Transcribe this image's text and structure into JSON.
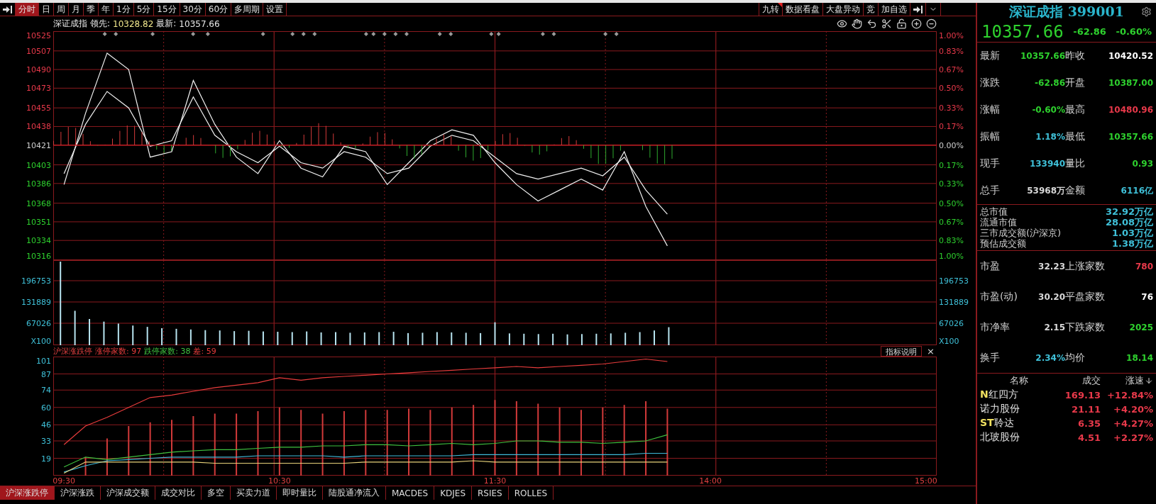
{
  "toolbar": {
    "tabs": [
      {
        "label": "分时",
        "selected": true
      },
      {
        "label": "日",
        "selected": false
      },
      {
        "label": "周",
        "selected": false
      },
      {
        "label": "月",
        "selected": false
      },
      {
        "label": "季",
        "selected": false
      },
      {
        "label": "年",
        "selected": false
      },
      {
        "label": "1分",
        "selected": false
      },
      {
        "label": "5分",
        "selected": false
      },
      {
        "label": "15分",
        "selected": false
      },
      {
        "label": "30分",
        "selected": false
      },
      {
        "label": "60分",
        "selected": false
      },
      {
        "label": "多周期",
        "selected": false
      },
      {
        "label": "设置",
        "selected": false
      }
    ],
    "buttons": [
      {
        "label": "九转",
        "flagged": true
      },
      {
        "label": "数据看盘",
        "flagged": false
      },
      {
        "label": "大盘异动",
        "flagged": false
      },
      {
        "label": "竞",
        "flagged": false
      },
      {
        "label": "加自选",
        "flagged": false
      }
    ]
  },
  "chart_header": {
    "name": "深证成指",
    "lead_label": "领先:",
    "lead_value": "10328.82",
    "latest_label": "最新:",
    "latest_value": "10357.66"
  },
  "price_chart": {
    "right_ticks": [
      "1.00%",
      "0.83%",
      "0.67%",
      "0.50%",
      "0.33%",
      "0.17%",
      "0.00%",
      "0.17%",
      "0.33%",
      "0.50%",
      "0.67%",
      "0.83%",
      "1.00%"
    ],
    "chart_data": {
      "type": "line",
      "grid": true,
      "ylim": [
        10316,
        10525
      ],
      "categories": [
        null,
        null,
        null,
        null,
        null,
        null,
        null,
        null,
        null,
        null,
        null,
        null,
        null,
        null,
        null,
        null,
        null,
        null,
        null,
        null,
        null,
        null,
        null,
        null,
        null,
        null,
        null,
        null,
        null,
        null,
        null,
        null,
        null,
        null,
        null,
        null,
        null,
        null,
        null,
        null,
        null
      ],
      "series": [
        {
          "color": "#f0f0f0",
          "values": [
            10395,
            10440,
            10470,
            10455,
            10420,
            10425,
            10465,
            10430,
            10415,
            10405,
            10420,
            10405,
            10400,
            10415,
            10410,
            10395,
            10400,
            10420,
            10430,
            10425,
            10410,
            10395,
            10390,
            10395,
            10400,
            10393,
            10410,
            10380,
            10358,
            null,
            null,
            null,
            null,
            null,
            null,
            null,
            null,
            null,
            null,
            null,
            null
          ]
        },
        {
          "color": "#f0f0f0",
          "values": [
            10385,
            10450,
            10505,
            10490,
            10410,
            10415,
            10480,
            10440,
            10410,
            10395,
            10425,
            10400,
            10392,
            10420,
            10415,
            10385,
            10405,
            10425,
            10435,
            10430,
            10405,
            10385,
            10370,
            10380,
            10390,
            10380,
            10415,
            10365,
            10329,
            null,
            null,
            null,
            null,
            null,
            null,
            null,
            null,
            null,
            null,
            null,
            null
          ]
        }
      ],
      "yticks": [
        {
          "value": 10525,
          "label": "10525"
        },
        {
          "value": 10507,
          "label": "10507"
        },
        {
          "value": 10490,
          "label": "10490"
        },
        {
          "value": 10473,
          "label": "10473"
        },
        {
          "value": 10455,
          "label": "10455"
        },
        {
          "value": 10438,
          "label": "10438"
        },
        {
          "value": 10421,
          "label": "10421"
        },
        {
          "value": 10403,
          "label": "10403"
        },
        {
          "value": 10386,
          "label": "10386"
        },
        {
          "value": 10368,
          "label": "10368"
        },
        {
          "value": 10351,
          "label": "10351"
        },
        {
          "value": 10334,
          "label": "10334"
        },
        {
          "value": 10316,
          "label": "10316"
        }
      ]
    }
  },
  "volume_chart": {
    "right_ticks": [
      "196753",
      "131889",
      "67026",
      "X100"
    ],
    "chart_data": {
      "type": "bar",
      "grid": true,
      "ylim": [
        0,
        259452
      ],
      "categories": [
        null,
        null,
        null,
        null,
        null,
        null,
        null,
        null,
        null,
        null,
        null,
        null,
        null,
        null,
        null,
        null,
        null,
        null,
        null,
        null,
        null,
        null,
        null,
        null,
        null,
        null,
        null,
        null,
        null,
        null,
        null,
        null,
        null,
        null,
        null,
        null,
        null,
        null,
        null,
        null,
        null,
        null,
        null,
        null,
        null,
        null,
        null,
        null,
        null,
        null,
        null,
        null,
        null,
        null,
        null,
        null,
        null,
        null,
        null,
        null,
        null
      ],
      "values": [
        255000,
        105000,
        80000,
        72000,
        66000,
        60000,
        56000,
        52000,
        50000,
        48000,
        46000,
        45000,
        43000,
        44000,
        42000,
        41000,
        40000,
        42000,
        39000,
        40000,
        38000,
        39000,
        40000,
        41000,
        37000,
        38000,
        40000,
        39000,
        38000,
        37000,
        70000,
        36000,
        35000,
        34000,
        35000,
        33000,
        34000,
        35000,
        36000,
        38000,
        40000,
        45000,
        55000,
        null,
        null,
        null,
        null,
        null,
        null,
        null,
        null,
        null,
        null,
        null,
        null,
        null,
        null,
        null,
        null,
        null,
        null
      ],
      "yticks": [
        {
          "value": 196753,
          "label": "196753"
        },
        {
          "value": 131889,
          "label": "131889"
        },
        {
          "value": 67026,
          "label": "67026"
        },
        {
          "value": 0,
          "label": "X100"
        }
      ]
    }
  },
  "indicator": {
    "title": "沪深涨跌停",
    "legend": [
      {
        "label": "涨停家数:",
        "value": "97",
        "color": "#e83c3c"
      },
      {
        "label": "跌停家数:",
        "value": "38",
        "color": "#3fc23f"
      },
      {
        "label": "差:",
        "value": "59",
        "color": "#e83c3c"
      }
    ],
    "help_button": "指标说明",
    "close": "×",
    "chart_data": {
      "type": "line",
      "grid": true,
      "ylim": [
        5,
        101
      ],
      "yticks": [
        19,
        33,
        46,
        60,
        74,
        87,
        101
      ],
      "categories": [
        "09:30",
        null,
        null,
        null,
        null,
        null,
        null,
        null,
        null,
        null,
        "10:30",
        null,
        null,
        null,
        null,
        null,
        null,
        null,
        null,
        null,
        "11:30",
        null,
        null,
        null,
        null,
        null,
        null,
        null,
        null,
        null,
        "14:00",
        null,
        null,
        null,
        null,
        null,
        null,
        null,
        null,
        null,
        "15:00"
      ],
      "series": [
        {
          "type": "bar",
          "color": "#d23a3a",
          "values": [
            5,
            20,
            35,
            45,
            48,
            50,
            53,
            55,
            55,
            57,
            60,
            58,
            55,
            57,
            58,
            58,
            59,
            58,
            60,
            62,
            66,
            65,
            63,
            60,
            58,
            60,
            62,
            65,
            59,
            null,
            null,
            null,
            null,
            null,
            null,
            null,
            null,
            null,
            null,
            null,
            null
          ]
        },
        {
          "color": "#e83c3c",
          "values": [
            30,
            45,
            52,
            60,
            68,
            70,
            73,
            76,
            78,
            80,
            84,
            82,
            84,
            85,
            86,
            87,
            88,
            89,
            90,
            91,
            92,
            93,
            92,
            93,
            94,
            95,
            97,
            99,
            97,
            null,
            null,
            null,
            null,
            null,
            null,
            null,
            null,
            null,
            null,
            null,
            null
          ]
        },
        {
          "color": "#3fc23f",
          "values": [
            12,
            20,
            18,
            20,
            22,
            24,
            25,
            26,
            26,
            27,
            28,
            28,
            29,
            29,
            30,
            30,
            29,
            30,
            31,
            30,
            31,
            33,
            33,
            32,
            32,
            31,
            32,
            33,
            38,
            null,
            null,
            null,
            null,
            null,
            null,
            null,
            null,
            null,
            null,
            null,
            null
          ]
        },
        {
          "color": "#3fb8d8",
          "values": [
            8,
            13,
            17,
            18,
            19,
            20,
            20,
            20,
            20,
            21,
            21,
            21,
            21,
            20,
            21,
            21,
            21,
            21,
            21,
            22,
            22,
            22,
            22,
            22,
            22,
            22,
            22,
            23,
            23,
            null,
            null,
            null,
            null,
            null,
            null,
            null,
            null,
            null,
            null,
            null,
            null
          ]
        },
        {
          "color": "#e8d27a",
          "values": [
            7,
            16,
            16,
            16,
            16,
            16,
            16,
            15,
            15,
            15,
            15,
            15,
            15,
            15,
            16,
            16,
            16,
            16,
            16,
            17,
            16,
            16,
            16,
            16,
            16,
            16,
            16,
            16,
            16,
            null,
            null,
            null,
            null,
            null,
            null,
            null,
            null,
            null,
            null,
            null,
            null
          ]
        }
      ]
    }
  },
  "bottom_tabs": [
    {
      "label": "沪深涨跌停",
      "selected": true
    },
    {
      "label": "沪深涨跌",
      "selected": false
    },
    {
      "label": "沪深成交额",
      "selected": false
    },
    {
      "label": "成交对比",
      "selected": false
    },
    {
      "label": "多空",
      "selected": false
    },
    {
      "label": "买卖力道",
      "selected": false
    },
    {
      "label": "即时量比",
      "selected": false
    },
    {
      "label": "陆股通净流入",
      "selected": false
    },
    {
      "label": "MACDES",
      "selected": false
    },
    {
      "label": "KDJES",
      "selected": false
    },
    {
      "label": "RSIES",
      "selected": false
    },
    {
      "label": "ROLLES",
      "selected": false
    }
  ],
  "quote": {
    "title": "深证成指 399001",
    "price": "10357.66",
    "change": "-62.86",
    "change_pct": "-0.60%",
    "color": "#2ed12e"
  },
  "stats": [
    {
      "label": "最新",
      "value": "10357.66",
      "color": "#2ed12e"
    },
    {
      "label": "昨收",
      "value": "10420.52",
      "color": "#ffffff"
    },
    {
      "label": "涨跌",
      "value": "-62.86",
      "color": "#2ed12e"
    },
    {
      "label": "开盘",
      "value": "10387.00",
      "color": "#2ed12e"
    },
    {
      "label": "涨幅",
      "value": "-0.60%",
      "color": "#2ed12e"
    },
    {
      "label": "最高",
      "value": "10480.96",
      "color": "#e8394a"
    },
    {
      "label": "振幅",
      "value": "1.18%",
      "color": "#3fc0d8"
    },
    {
      "label": "最低",
      "value": "10357.66",
      "color": "#2ed12e"
    },
    {
      "label": "现手",
      "value": "133940",
      "color": "#3fc0d8"
    },
    {
      "label": "量比",
      "value": "0.93",
      "color": "#2ed12e"
    },
    {
      "label": "总手",
      "value": "53968万",
      "color": "#d8d8d8"
    },
    {
      "label": "金额",
      "value": "6116亿",
      "color": "#3fc0d8"
    }
  ],
  "market_value": [
    {
      "label": "总市值",
      "value": "32.92万亿"
    },
    {
      "label": "流通市值",
      "value": "28.08万亿"
    },
    {
      "label": "三市成交额(沪深京)",
      "value": "1.03万亿"
    },
    {
      "label": "预估成交额",
      "value": "1.38万亿"
    }
  ],
  "valuation": [
    {
      "label": "市盈",
      "value": "32.23",
      "color": "#d8d8d8"
    },
    {
      "label": "上涨家数",
      "value": "780",
      "color": "#e8394a"
    },
    {
      "label": "市盈(动)",
      "value": "30.20",
      "color": "#d8d8d8"
    },
    {
      "label": "平盘家数",
      "value": "76",
      "color": "#ffffff"
    },
    {
      "label": "市净率",
      "value": "2.15",
      "color": "#d8d8d8"
    },
    {
      "label": "下跌家数",
      "value": "2025",
      "color": "#2ed12e"
    },
    {
      "label": "换手",
      "value": "2.34%",
      "color": "#3fc0d8"
    },
    {
      "label": "均价",
      "value": "18.14",
      "color": "#2ed12e"
    }
  ],
  "movers": {
    "columns": [
      "名称",
      "成交",
      "涨速"
    ],
    "rows": [
      {
        "prefix": "N",
        "name": "红四方",
        "price": "169.13",
        "speed": "+12.84%"
      },
      {
        "name": "诺力股份",
        "price": "21.11",
        "speed": "+4.20%"
      },
      {
        "prefix": "ST",
        "name": "聆达",
        "price": "6.35",
        "speed": "+4.27%"
      },
      {
        "name": "北玻股份",
        "price": "4.51",
        "speed": "+2.27%"
      }
    ]
  }
}
